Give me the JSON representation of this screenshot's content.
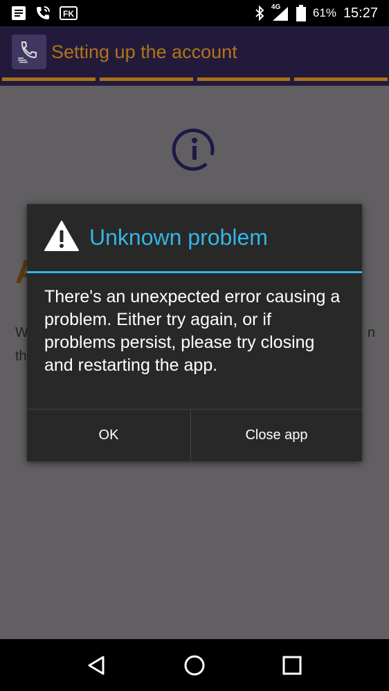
{
  "status_bar": {
    "icons_left": [
      "notes-icon",
      "phone-call-icon",
      "fk-app-icon"
    ],
    "icons_right": [
      "bluetooth-icon",
      "signal-4g-icon",
      "battery-icon"
    ],
    "network": "4G",
    "battery": "61%",
    "time": "15:27"
  },
  "app_bar": {
    "title": "Setting up the account",
    "logo_icon": "phone-hand-icon",
    "background_color": "#231a3b",
    "title_color": "#b07419"
  },
  "progress": {
    "segments": 4,
    "color": "#a8731c"
  },
  "background": {
    "info_icon": "info-circle-icon",
    "heading": "A",
    "text_line1": "W",
    "text_line1_end": "n",
    "text_line2": "th"
  },
  "dialog": {
    "title": "Unknown problem",
    "icon": "warning-icon",
    "message": "There's an unexpected error causing a problem. Either try again, or if problems persist, please try closing and restarting the app.",
    "ok_label": "OK",
    "close_label": "Close app",
    "accent_color": "#33b5e5"
  },
  "nav_bar": {
    "buttons": [
      "back-icon",
      "home-icon",
      "recents-icon"
    ]
  }
}
